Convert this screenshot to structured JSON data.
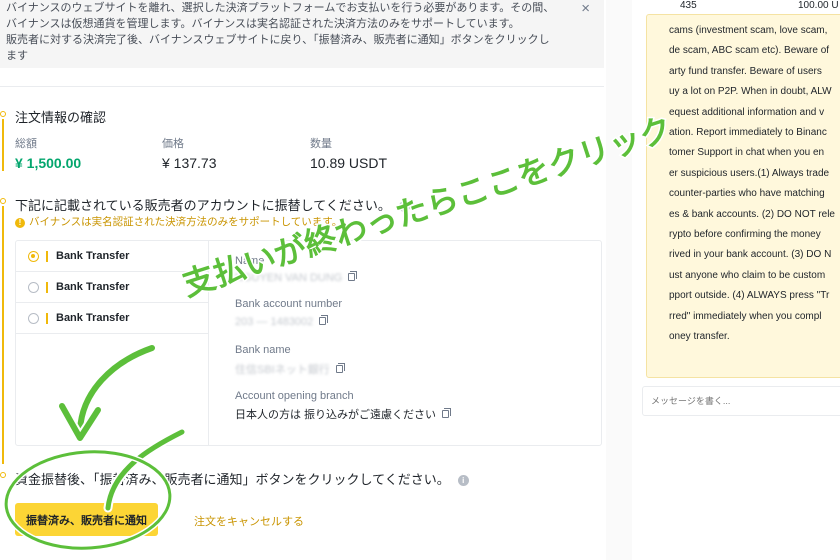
{
  "notice": {
    "line1": "バイナンスのウェブサイトを離れ、選択した決済プラットフォームでお支払いを行う必要があります。その間、",
    "line2": "バイナンスは仮想通貨を管理します。バイナンスは実名認証された決済方法のみをサポートしています。",
    "line3": "販売者に対する決済完了後、バイナンスウェブサイトに戻り、「振替済み、販売者に通知」ボタンをクリックし",
    "line4": "ます",
    "close_glyph": "×"
  },
  "order_info": {
    "title": "注文情報の確認",
    "total_label": "総額",
    "total_value": "¥ 1,500.00",
    "price_label": "価格",
    "price_value": "¥ 137.73",
    "qty_label": "数量",
    "qty_value": "10.89 USDT"
  },
  "transfer": {
    "title": "下記に記載されている販売者のアカウントに振替してください。",
    "warning_icon": "!",
    "warning": "バイナンスは実名認証された決済方法のみをサポートしています。",
    "methods": [
      {
        "label": "Bank Transfer",
        "selected": true
      },
      {
        "label": "Bank Transfer",
        "selected": false
      },
      {
        "label": "Bank Transfer",
        "selected": false
      }
    ],
    "name_label": "Name",
    "name_value": "NGUYEN VAN DUNG",
    "account_label": "Bank account number",
    "account_value": "203 — 1483002",
    "bank_label": "Bank name",
    "bank_value": "住信SBIネット銀行",
    "branch_label": "Account opening branch",
    "branch_value": "日本人の方は 振り込みがご遠慮ください"
  },
  "confirm": {
    "title": "資金振替後、「振替済み、販売者に通知」ボタンをクリックしてください。",
    "notify_button": "振替済み、販売者に通知",
    "cancel_link": "注文をキャンセルする"
  },
  "chat": {
    "top_left": "435",
    "top_right": "100.00 U",
    "lines": [
      "cams (investment scam, love scam,",
      "de scam, ABC scam etc). Beware of",
      "arty fund transfer. Beware of users",
      "uy a lot on P2P. When in doubt, ALW",
      "equest additional information and v",
      "ation. Report immediately to Binanc",
      "tomer Support in chat when you en",
      "er suspicious users.(1) Always trade",
      "counter-parties who have matching",
      "es & bank accounts. (2) DO NOT rele",
      "rypto before confirming the money",
      "rived in your bank account. (3) DO N",
      "ust anyone who claim to be custom",
      "pport outside. (4) ALWAYS press \"Tr",
      "rred\" immediately when you compl",
      "oney transfer."
    ],
    "input_placeholder": "メッセージを書く..."
  },
  "annotation": {
    "text": "支払いが終わったらここをクリック",
    "color": "#5cbf3a"
  },
  "colors": {
    "accent": "#f0b90b",
    "button": "#fcd535",
    "positive": "#03a66d"
  }
}
